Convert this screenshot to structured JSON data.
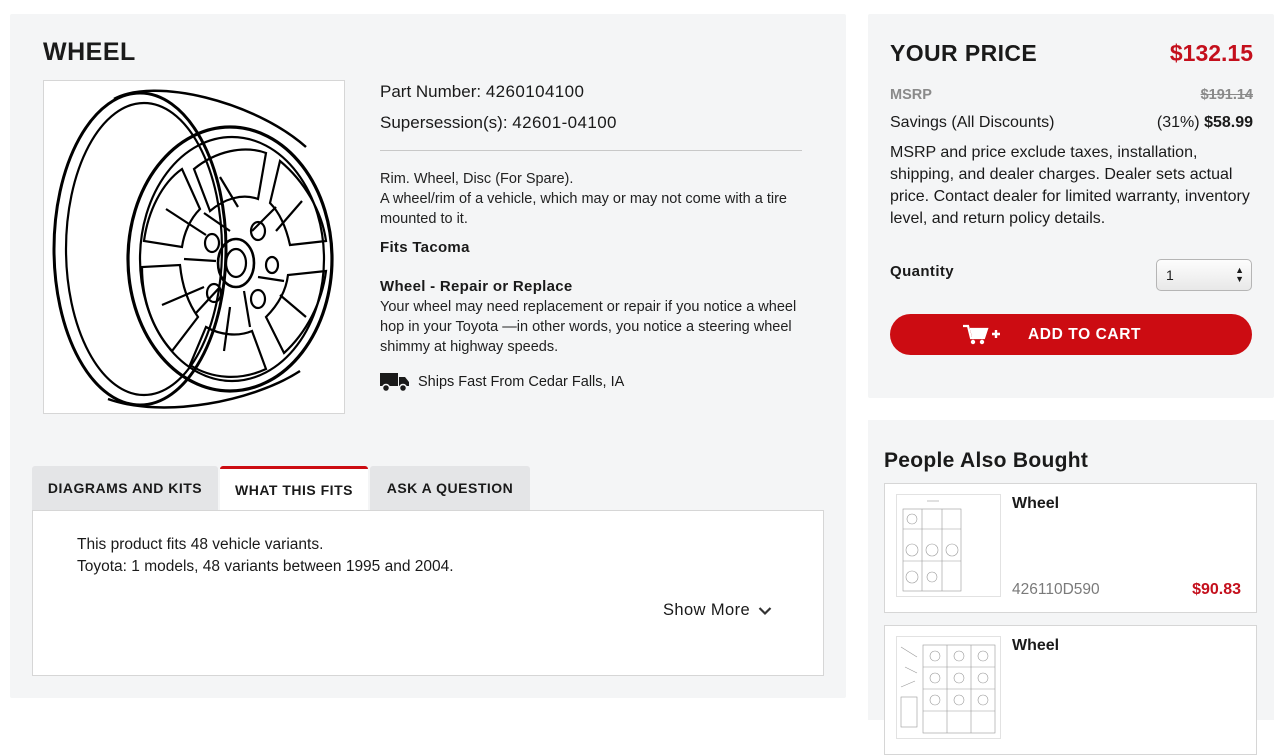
{
  "product": {
    "title": "WHEEL",
    "part_number_label": "Part Number:",
    "part_number": "4260104100",
    "supersession_label": "Supersession(s):",
    "supersession": "42601-04100",
    "desc_line1": "Rim. Wheel, Disc (For Spare).",
    "desc_line2": "A wheel/rim of a vehicle, which may or may not come with a tire mounted to it.",
    "fits": "Fits Tacoma",
    "repair_title": "Wheel - Repair or Replace",
    "repair_text": "Your wheel may need replacement or repair if you notice a wheel hop in your Toyota —in other words, you notice a steering wheel shimmy at highway speeds.",
    "ships": "Ships Fast From Cedar Falls, IA"
  },
  "tabs": [
    {
      "label": "DIAGRAMS AND KITS",
      "active": false
    },
    {
      "label": "WHAT THIS FITS",
      "active": true
    },
    {
      "label": "ASK A QUESTION",
      "active": false
    }
  ],
  "fits_panel": {
    "line1": "This product fits 48 vehicle variants.",
    "line2": "Toyota: 1 models, 48 variants between 1995 and 2004.",
    "show_more": "Show More"
  },
  "pricing": {
    "your_price_label": "YOUR PRICE",
    "your_price": "$132.15",
    "msrp_label": "MSRP",
    "msrp": "$191.14",
    "savings_label": "Savings (All Discounts)",
    "savings_pct": "(31%)",
    "savings_amount": "$58.99",
    "disclaimer": "MSRP and price exclude taxes, installation, shipping, and dealer charges. Dealer sets actual price. Contact dealer for limited warranty, inventory level, and return policy details.",
    "quantity_label": "Quantity",
    "quantity_value": "1",
    "add_to_cart": "ADD TO CART"
  },
  "also_bought": {
    "title": "People Also Bought",
    "items": [
      {
        "name": "Wheel",
        "part": "426110D590",
        "price": "$90.83"
      },
      {
        "name": "Wheel",
        "part": "",
        "price": ""
      }
    ]
  },
  "colors": {
    "accent_red": "#cc0c12",
    "price_red": "#c40f1c",
    "panel_bg": "#f4f5f6"
  },
  "icons": [
    "wheel-diagram-image",
    "truck-icon",
    "chevron-down-icon",
    "cart-plus-icon",
    "select-arrows-icon"
  ]
}
